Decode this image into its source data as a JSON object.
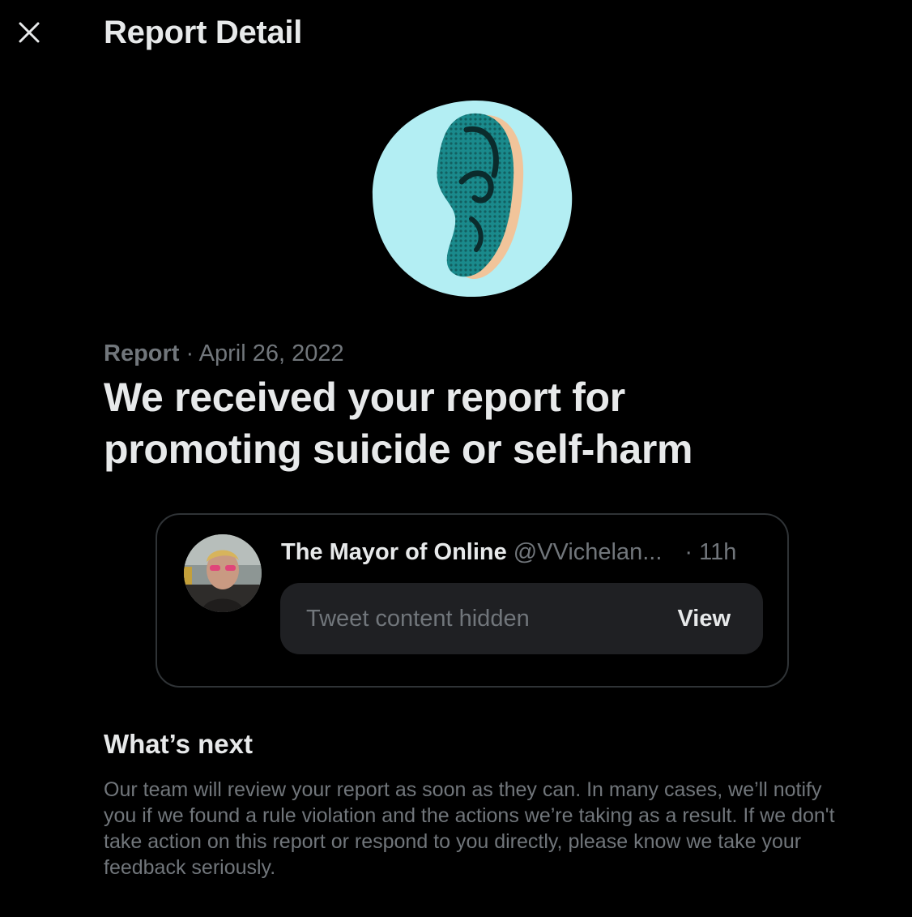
{
  "header": {
    "title": "Report Detail",
    "close_icon": "close-icon"
  },
  "illustration": {
    "icon": "ear-icon",
    "bg_color": "#b3eef3",
    "ear_color": "#1a8a8c",
    "shadow_color": "#f1c49a"
  },
  "report": {
    "label": "Report",
    "separator": "·",
    "date": "April 26, 2022",
    "headline": "We received your report for promoting suicide or self-harm"
  },
  "tweet": {
    "display_name": "The Mayor of Online",
    "handle": "@VVichelan...",
    "time": "· 11h",
    "hidden_text": "Tweet content hidden",
    "view_label": "View"
  },
  "next": {
    "heading": "What’s next",
    "body": "Our team will review your report as soon as they can. In many cases, we’ll notify you if we found a rule violation and the actions we’re taking as a result. If we don't take action on this report or respond to you directly, please know we take your feedback seriously."
  },
  "colors": {
    "background": "#000000",
    "primary_text": "#e7e9ea",
    "secondary_text": "#71767b",
    "border": "#2f3336",
    "hidden_box": "#1f2023"
  }
}
